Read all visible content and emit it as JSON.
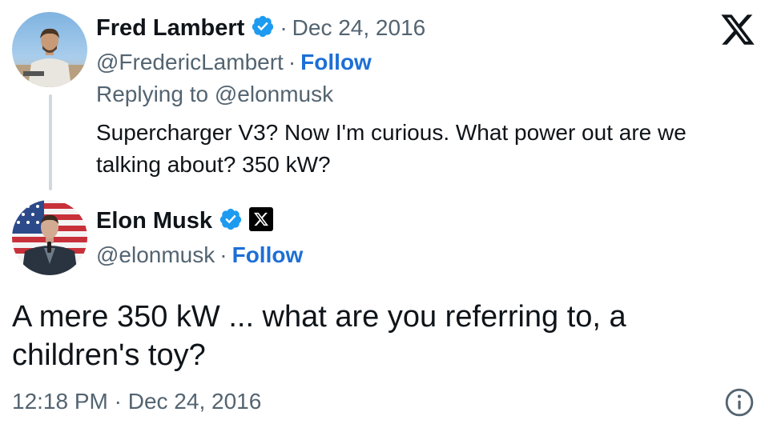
{
  "parent_tweet": {
    "author_name": "Fred Lambert",
    "separator": "·",
    "date": "Dec 24, 2016",
    "handle": "@FredericLambert",
    "follow_label": "Follow",
    "replying_to": "Replying to @elonmusk",
    "text_line1": "Supercharger V3? Now I'm curious. What power out are we",
    "text_line2": "talking about? 350 kW?"
  },
  "main_tweet": {
    "author_name": "Elon Musk",
    "handle": "@elonmusk",
    "separator": "·",
    "follow_label": "Follow",
    "text_line1": "A mere 350 kW ... what are you referring to, a",
    "text_line2": "children's toy?",
    "timestamp": "12:18 PM · Dec 24, 2016"
  },
  "icons": {
    "verified": "verified-badge-icon",
    "platform": "x-logo-icon",
    "affiliate": "x-affiliate-badge-icon",
    "info": "info-icon"
  },
  "colors": {
    "follow": "#1d6fd6",
    "verified": "#1d9bf0",
    "muted": "#536471",
    "text": "#0f1419",
    "thread_line": "#cfd9de"
  }
}
